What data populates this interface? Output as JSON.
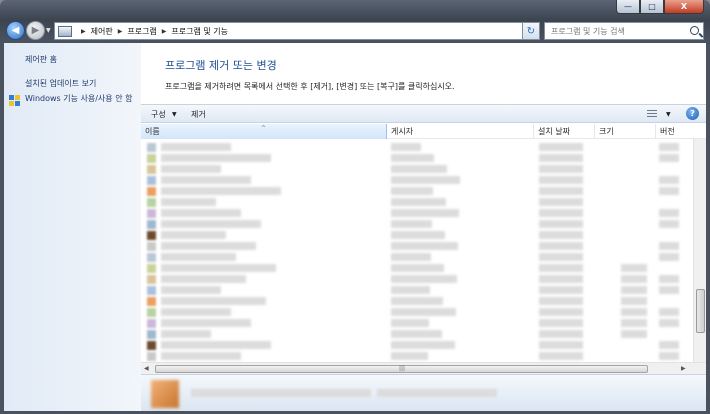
{
  "window": {
    "buttons": {
      "minimize": "—",
      "maximize": "□",
      "close": "X"
    }
  },
  "address": {
    "breadcrumbs": [
      "제어판",
      "프로그램",
      "프로그램 및 기능"
    ],
    "search_placeholder": "프로그램 및 기능 검색"
  },
  "sidebar": {
    "items": [
      {
        "label": "제어판 홈"
      },
      {
        "label": "설치된 업데이트 보기"
      },
      {
        "label": "Windows 기능 사용/사용 안 함"
      }
    ]
  },
  "main": {
    "title": "프로그램 제거 또는 변경",
    "description": "프로그램을 제거하려면 목록에서 선택한 후 [제거], [변경] 또는 [복구]를 클릭하십시오."
  },
  "toolbar": {
    "organize_label": "구성",
    "uninstall_label": "제거",
    "help_label": "?"
  },
  "columns": {
    "name": "이름",
    "publisher": "게시자",
    "install_date": "설치 날짜",
    "size": "크기",
    "version": "버전"
  },
  "colors": {
    "accent": "#1f4f97",
    "sidebar_link": "#1e3a6a",
    "selected_header": "#d2e6fa"
  },
  "icons": {
    "back": "back-arrow-icon",
    "forward": "forward-arrow-icon",
    "refresh": "refresh-icon",
    "search": "search-icon",
    "view": "view-options-icon",
    "help": "help-icon",
    "shield": "windows-shield-icon"
  }
}
